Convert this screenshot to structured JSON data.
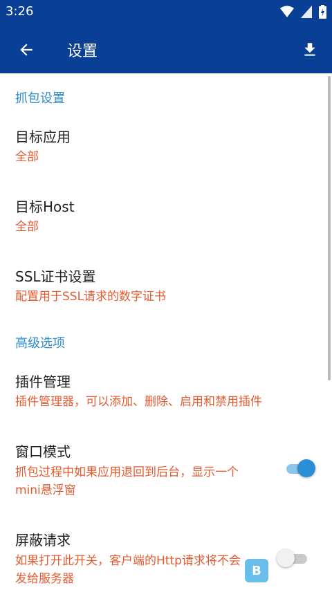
{
  "status_bar": {
    "time": "3:26"
  },
  "app_bar": {
    "title": "设置"
  },
  "sections": {
    "capture": {
      "header": "抓包设置",
      "target_app": {
        "title": "目标应用",
        "summary": "全部"
      },
      "target_host": {
        "title": "目标Host",
        "summary": "全部"
      },
      "ssl": {
        "title": "SSL证书设置",
        "summary": "配置用于SSL请求的数字证书"
      }
    },
    "advanced": {
      "header": "高级选项",
      "plugins": {
        "title": "插件管理",
        "summary": "插件管理器，可以添加、删除、启用和禁用插件"
      },
      "window_mode": {
        "title": "窗口模式",
        "summary_line1": "抓包过程中如果应用退回到后台，显示一个",
        "summary_line2": "mini悬浮窗",
        "enabled": true
      },
      "block_requests": {
        "title": "屏蔽请求",
        "summary_line1": "如果打开此开关，客户端的Http请求将不会",
        "summary_line2": "发给服务器",
        "enabled": false
      }
    }
  },
  "icons": {
    "wifi": "wifi-icon",
    "signal": "signal-icon",
    "battery": "battery-icon",
    "back": "arrow-back-icon",
    "download": "download-icon"
  },
  "colors": {
    "app_bar": "#0a3f96",
    "section_header": "#2d8ccf",
    "summary": "#e7592e",
    "toggle_on": "#2b8fd6"
  }
}
